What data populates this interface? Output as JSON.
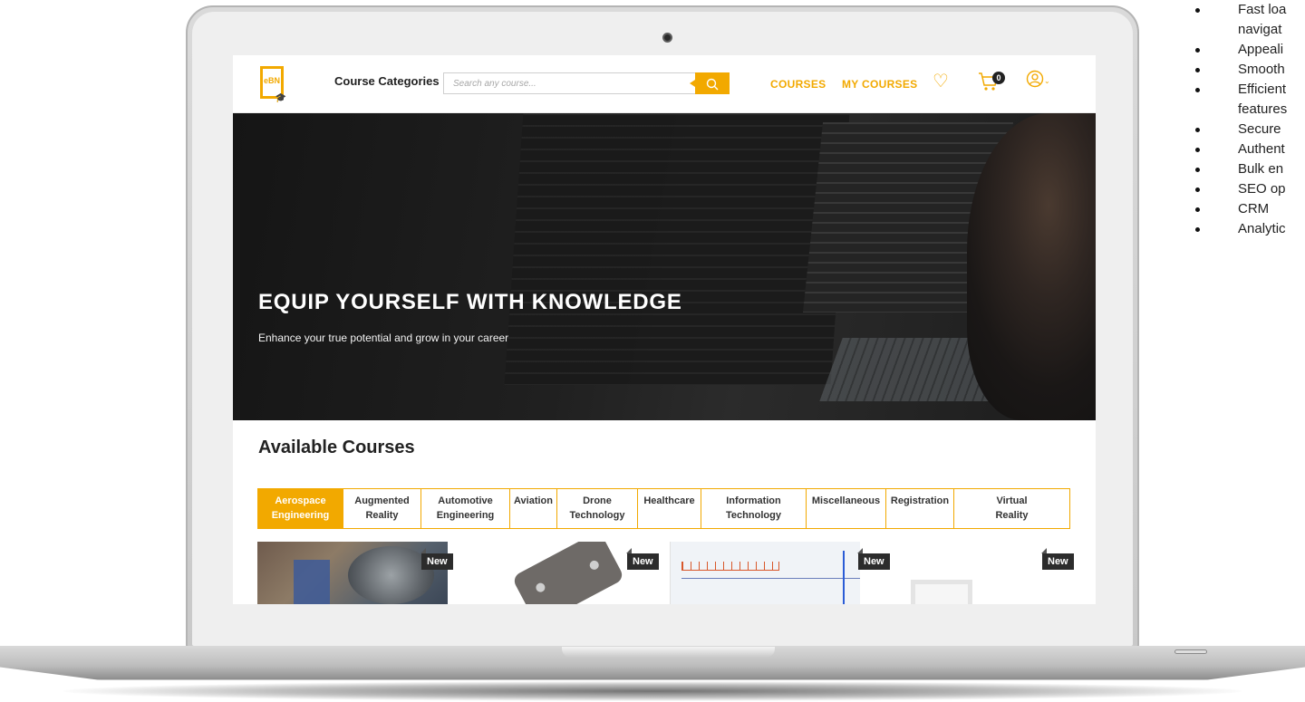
{
  "header": {
    "logo_text": "eBN",
    "course_categories": "Course Categories",
    "search_placeholder": "Search any course...",
    "nav": {
      "courses": "COURSES",
      "my_courses": "MY COURSES"
    },
    "cart_count": "0",
    "icons": [
      "search-icon",
      "heart-icon",
      "cart-icon",
      "user-icon",
      "chevron-down-icon"
    ]
  },
  "hero": {
    "title": "EQUIP YOURSELF WITH KNOWLEDGE",
    "subtitle": "Enhance your true potential and grow in your career"
  },
  "courses": {
    "section_title": "Available Courses",
    "tabs": [
      {
        "line1": "Aerospace",
        "line2": "Engineering",
        "active": true
      },
      {
        "line1": "Augmented",
        "line2": "Reality",
        "active": false
      },
      {
        "line1": "Automotive",
        "line2": "Engineering",
        "active": false
      },
      {
        "line1": "Aviation",
        "line2": "",
        "active": false
      },
      {
        "line1": "Drone",
        "line2": "Technology",
        "active": false
      },
      {
        "line1": "Healthcare",
        "line2": "",
        "active": false
      },
      {
        "line1": "Information",
        "line2": "Technology",
        "active": false
      },
      {
        "line1": "Miscellaneous",
        "line2": "",
        "active": false
      },
      {
        "line1": "Registration",
        "line2": "",
        "active": false
      },
      {
        "line1": "Virtual",
        "line2": "Reality",
        "active": false
      }
    ],
    "card_badge": "New"
  },
  "features": [
    "Fast loa",
    "navigat",
    "Appeali",
    "Smooth",
    "Efficient",
    "features",
    "Secure",
    "Authent",
    "Bulk en",
    "SEO op",
    "CRM",
    "Analytic"
  ],
  "colors": {
    "accent": "#f2a900",
    "dark": "#222222",
    "hero_bg": "#1c1c1c"
  }
}
